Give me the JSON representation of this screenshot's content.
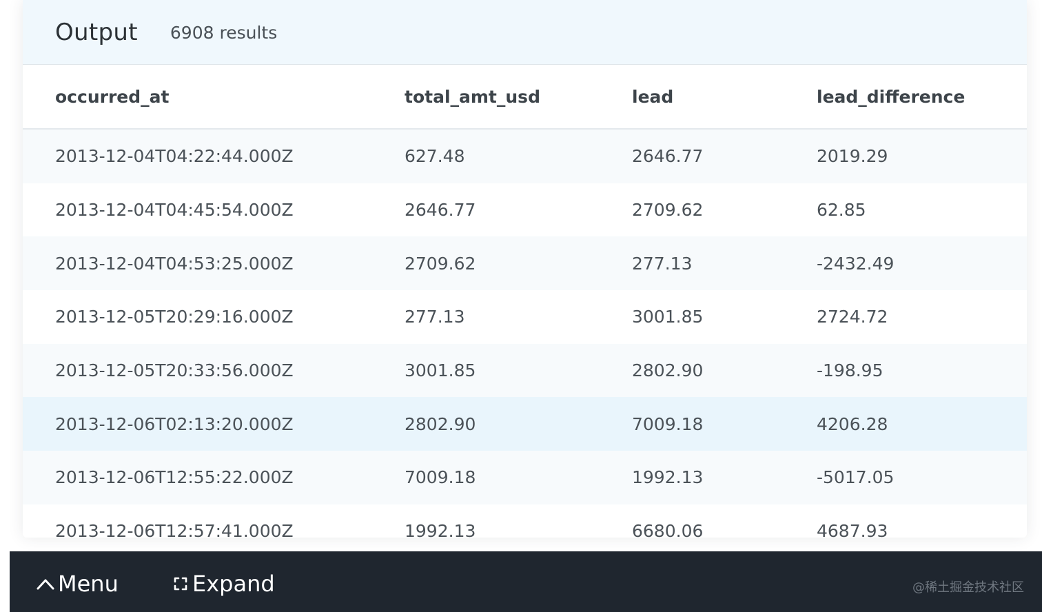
{
  "output": {
    "title": "Output",
    "result_count": "6908 results"
  },
  "table": {
    "columns": [
      "occurred_at",
      "total_amt_usd",
      "lead",
      "lead_difference"
    ],
    "rows": [
      [
        "2013-12-04T04:22:44.000Z",
        "627.48",
        "2646.77",
        "2019.29"
      ],
      [
        "2013-12-04T04:45:54.000Z",
        "2646.77",
        "2709.62",
        "62.85"
      ],
      [
        "2013-12-04T04:53:25.000Z",
        "2709.62",
        "277.13",
        "-2432.49"
      ],
      [
        "2013-12-05T20:29:16.000Z",
        "277.13",
        "3001.85",
        "2724.72"
      ],
      [
        "2013-12-05T20:33:56.000Z",
        "3001.85",
        "2802.90",
        "-198.95"
      ],
      [
        "2013-12-06T02:13:20.000Z",
        "2802.90",
        "7009.18",
        "4206.28"
      ],
      [
        "2013-12-06T12:55:22.000Z",
        "7009.18",
        "1992.13",
        "-5017.05"
      ],
      [
        "2013-12-06T12:57:41.000Z",
        "1992.13",
        "6680.06",
        "4687.93"
      ]
    ]
  },
  "bottom_bar": {
    "menu_label": "Menu",
    "menu_icon": "chevron-up-icon",
    "expand_label": "Expand",
    "expand_icon": "expand-icon",
    "watermark": "@稀土掘金技术社区"
  },
  "colors": {
    "header_bg": "#f0f8fd",
    "highlight_row": "#e9f5fc",
    "bottom_bar_bg": "#1f262f"
  }
}
